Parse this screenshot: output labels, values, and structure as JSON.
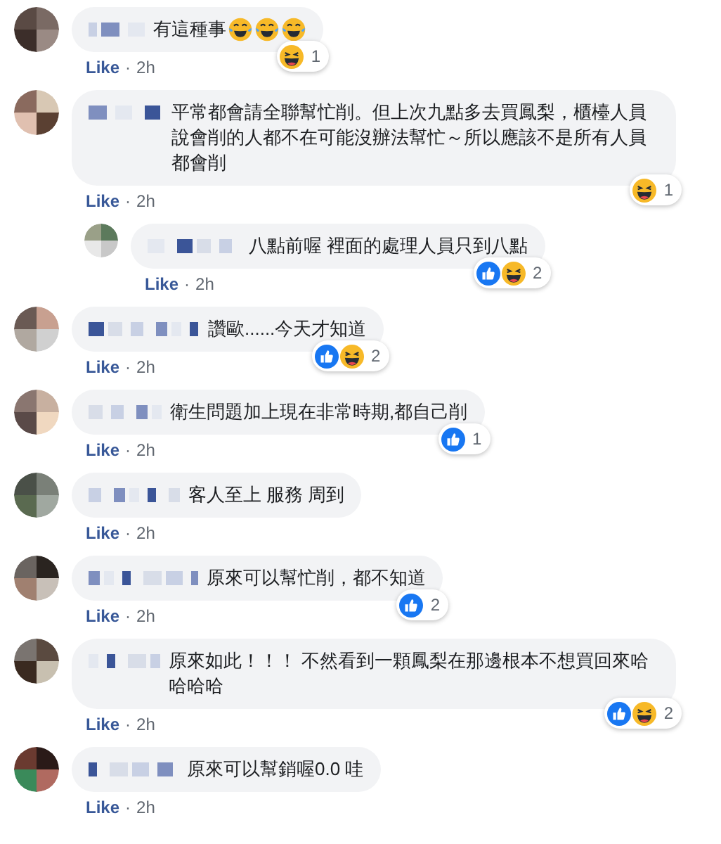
{
  "comments": [
    {
      "text": "有這種事",
      "emoji": [
        {
          "kind": "laugh-cry"
        },
        {
          "kind": "laugh-cry"
        },
        {
          "kind": "laugh-cry"
        }
      ],
      "reactions": {
        "items": [
          {
            "kind": "haha"
          }
        ],
        "count": "1"
      },
      "like": "Like",
      "separator": "·",
      "time": "2h"
    },
    {
      "text": "平常都會請全聯幫忙削。但上次九點多去買鳳梨，櫃檯人員說會削的人都不在可能沒辦法幫忙～所以應該不是所有人員都會削",
      "reactions": {
        "items": [
          {
            "kind": "haha"
          }
        ],
        "count": "1"
      },
      "like": "Like",
      "separator": "·",
      "time": "2h",
      "children": [
        {
          "text": "八點前喔 裡面的處理人員只到八點",
          "reactions": {
            "items": [
              {
                "kind": "like"
              },
              {
                "kind": "haha"
              }
            ],
            "count": "2"
          },
          "like": "Like",
          "separator": "·",
          "time": "2h"
        }
      ]
    },
    {
      "text": "讚歐......今天才知道",
      "reactions": {
        "items": [
          {
            "kind": "like"
          },
          {
            "kind": "haha"
          }
        ],
        "count": "2"
      },
      "like": "Like",
      "separator": "·",
      "time": "2h"
    },
    {
      "text": "衛生問題加上現在非常時期,都自己削",
      "reactions": {
        "items": [
          {
            "kind": "like"
          }
        ],
        "count": "1"
      },
      "like": "Like",
      "separator": "·",
      "time": "2h"
    },
    {
      "text": "客人至上 服務 周到",
      "like": "Like",
      "separator": "·",
      "time": "2h"
    },
    {
      "text": "原來可以幫忙削，都不知道",
      "reactions": {
        "items": [
          {
            "kind": "like"
          }
        ],
        "count": "2"
      },
      "like": "Like",
      "separator": "·",
      "time": "2h"
    },
    {
      "text": "原來如此！！！ 不然看到一顆鳳梨在那邊根本不想買回來哈哈哈哈",
      "reactions": {
        "items": [
          {
            "kind": "like"
          },
          {
            "kind": "haha"
          }
        ],
        "count": "2"
      },
      "like": "Like",
      "separator": "·",
      "time": "2h"
    },
    {
      "text": "原來可以幫銷喔0.0 哇",
      "like": "Like",
      "separator": "·",
      "time": "2h"
    }
  ]
}
